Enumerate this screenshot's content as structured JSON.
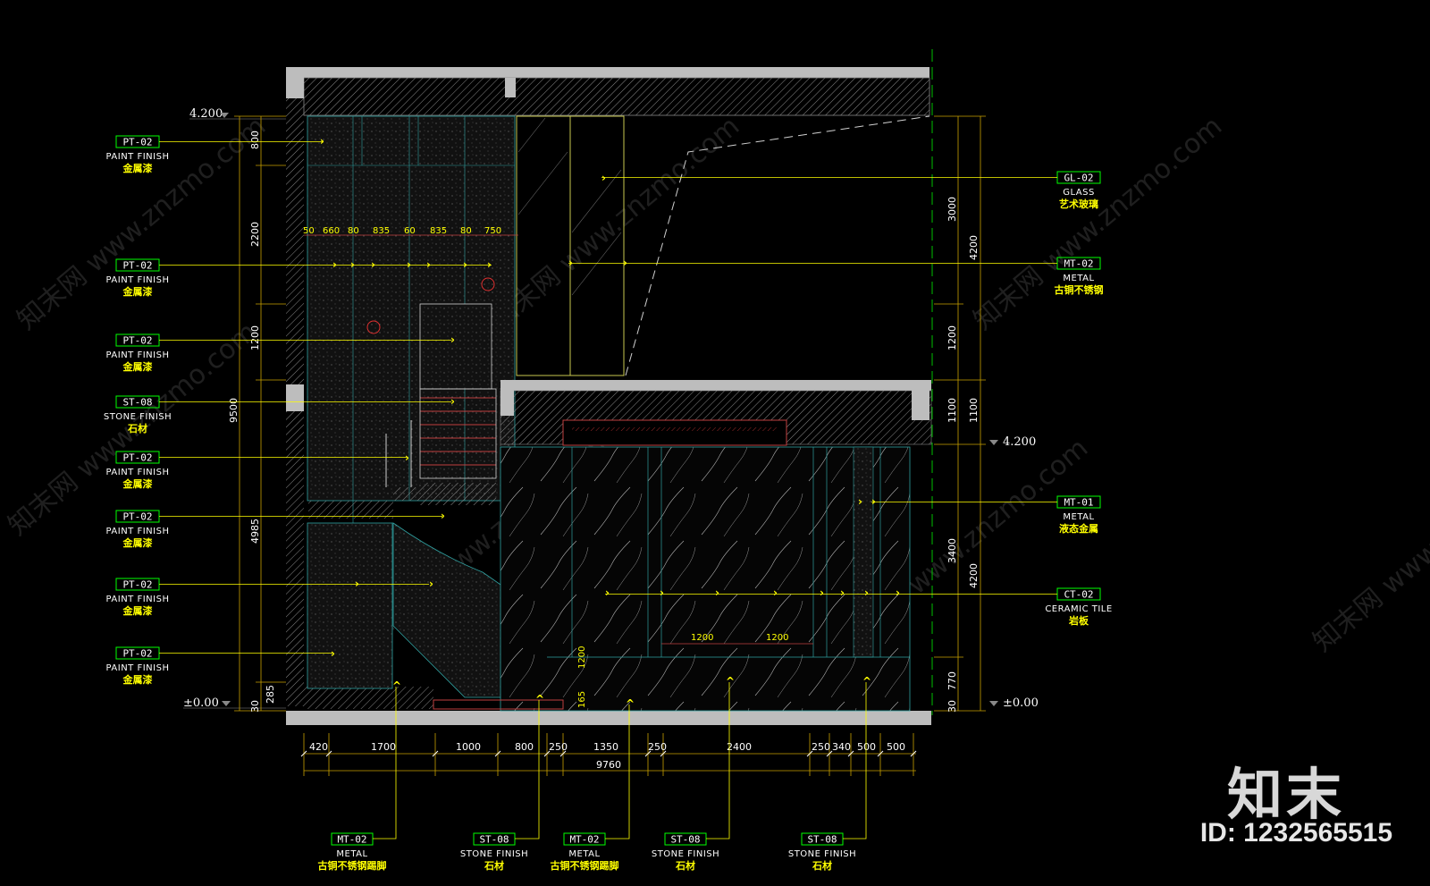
{
  "levels": {
    "top": "4.200",
    "ground": "±0.00",
    "mid": "4.200",
    "ground_right": "±0.00"
  },
  "left_tags": [
    {
      "code": "PT-02",
      "en": "PAINT FINISH",
      "cn": "金属漆"
    },
    {
      "code": "PT-02",
      "en": "PAINT FINISH",
      "cn": "金属漆"
    },
    {
      "code": "PT-02",
      "en": "PAINT FINISH",
      "cn": "金属漆"
    },
    {
      "code": "ST-08",
      "en": "STONE FINISH",
      "cn": "石材"
    },
    {
      "code": "PT-02",
      "en": "PAINT FINISH",
      "cn": "金属漆"
    },
    {
      "code": "PT-02",
      "en": "PAINT FINISH",
      "cn": "金属漆"
    },
    {
      "code": "PT-02",
      "en": "PAINT FINISH",
      "cn": "金属漆"
    },
    {
      "code": "PT-02",
      "en": "PAINT FINISH",
      "cn": "金属漆"
    }
  ],
  "right_tags": [
    {
      "code": "GL-02",
      "en": "GLASS",
      "cn": "艺术玻璃"
    },
    {
      "code": "MT-02",
      "en": "METAL",
      "cn": "古铜不锈钢"
    },
    {
      "code": "MT-01",
      "en": "METAL",
      "cn": "液态金属"
    },
    {
      "code": "CT-02",
      "en": "CERAMIC TILE",
      "cn": "岩板"
    }
  ],
  "bottom_tags": [
    {
      "code": "MT-02",
      "en": "METAL",
      "cn": "古铜不锈钢踢脚"
    },
    {
      "code": "ST-08",
      "en": "STONE FINISH",
      "cn": "石材"
    },
    {
      "code": "MT-02",
      "en": "METAL",
      "cn": "古铜不锈钢踢脚"
    },
    {
      "code": "ST-08",
      "en": "STONE FINISH",
      "cn": "石材"
    },
    {
      "code": "ST-08",
      "en": "STONE FINISH",
      "cn": "石材"
    }
  ],
  "left_dims": [
    "800",
    "2200",
    "1200",
    "9500",
    "4985",
    "285",
    "30"
  ],
  "right_dims_inner": [
    "3000",
    "1200",
    "1100",
    "3400",
    "770",
    "30"
  ],
  "right_dims_outer": [
    "4200",
    "1100",
    "4200"
  ],
  "bottom_dims": [
    "420",
    "1700",
    "1000",
    "800",
    "250",
    "1350",
    "250",
    "2400",
    "250",
    "340",
    "500",
    "500"
  ],
  "bottom_total": "9760",
  "panel_dims": [
    "50",
    "660",
    "80",
    "835",
    "60",
    "835",
    "80",
    "750"
  ],
  "inner_dims": [
    "1200",
    "1200",
    "1200",
    "165"
  ],
  "watermark": "知末网 www.znzmo.com",
  "brand": "知末",
  "id_text": "ID: 1232565515"
}
